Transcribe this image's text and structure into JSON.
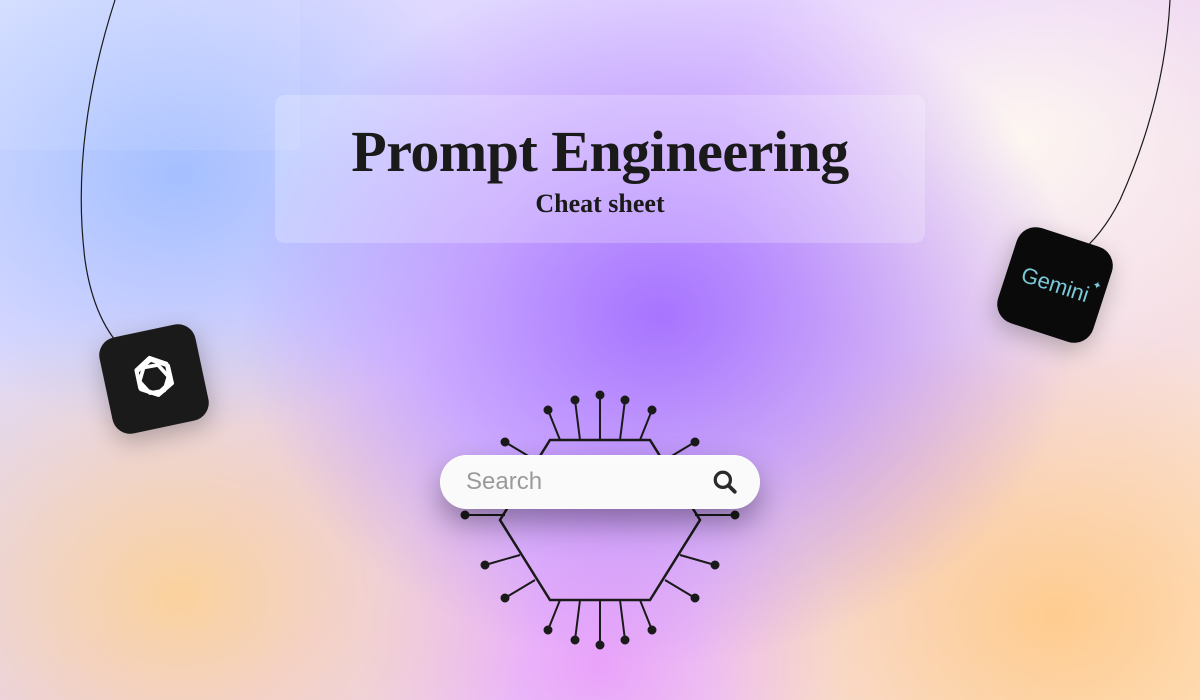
{
  "header": {
    "title": "Prompt Engineering",
    "subtitle": "Cheat sheet"
  },
  "search": {
    "placeholder": "Search"
  },
  "badges": {
    "gemini_label": "Gemini"
  }
}
